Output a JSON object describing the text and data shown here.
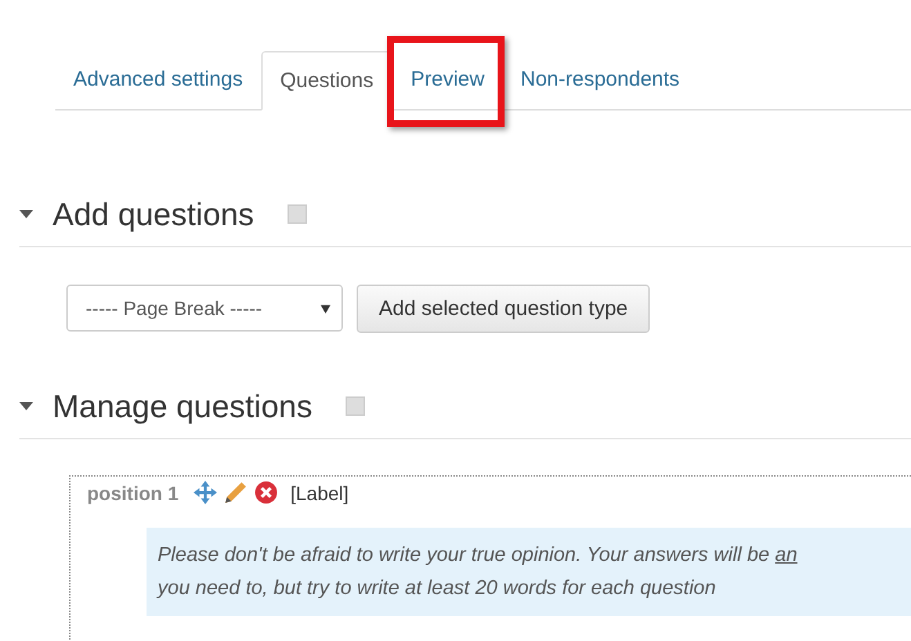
{
  "tabs": [
    {
      "label": "Advanced settings",
      "selected": false,
      "highlighted": false
    },
    {
      "label": "Questions",
      "selected": true,
      "highlighted": false
    },
    {
      "label": "Preview",
      "selected": false,
      "highlighted": true
    },
    {
      "label": "Non-respondents",
      "selected": false,
      "highlighted": false
    }
  ],
  "sections": [
    {
      "title": "Add questions",
      "expanded": true
    },
    {
      "title": "Manage questions",
      "expanded": true
    }
  ],
  "add_questions": {
    "select_value": "----- Page Break -----",
    "button": "Add selected question type"
  },
  "question": {
    "position": "position 1",
    "type": "[Label]",
    "text_line_1": "Please don't be afraid to write your true opinion. Your answers will be ",
    "text_link": "an",
    "text_line_2": "you need to, but try to write at least 20 words for each question"
  }
}
